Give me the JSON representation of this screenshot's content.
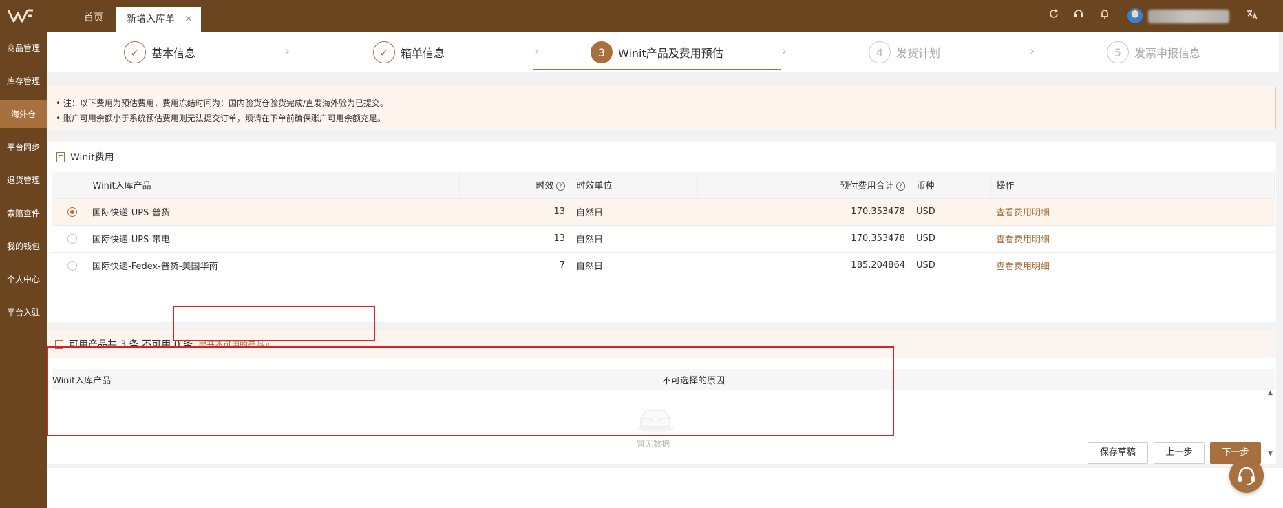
{
  "topbar": {
    "tabs": {
      "home": "首页",
      "active": "新增入库单"
    }
  },
  "sidebar": {
    "items": [
      "商品管理",
      "库存管理",
      "海外仓",
      "平台同步",
      "退货管理",
      "索赔查件",
      "我的钱包",
      "个人中心",
      "平台入驻"
    ],
    "active_index": 2
  },
  "steps": [
    {
      "num": "1",
      "label": "基本信息",
      "state": "done"
    },
    {
      "num": "2",
      "label": "箱单信息",
      "state": "done"
    },
    {
      "num": "3",
      "label": "Winit产品及费用预估",
      "state": "current"
    },
    {
      "num": "4",
      "label": "发货计划",
      "state": "pending"
    },
    {
      "num": "5",
      "label": "发票申报信息",
      "state": "pending"
    }
  ],
  "notice": {
    "line1": "• 注：以下费用为预估费用，费用冻结时间为：国内验货仓验货完成/直发海外验为已提交。",
    "line2": "• 账户可用余额小于系统预估费用则无法提交订单，烦请在下单前确保账户可用余额充足。"
  },
  "fee_section": {
    "title": "Winit费用",
    "columns": {
      "product": "Winit入库产品",
      "time": "时效",
      "time_unit": "时效单位",
      "total": "预付费用合计",
      "currency": "币种",
      "action": "操作"
    },
    "rows": [
      {
        "selected": true,
        "product": "国际快递-UPS-普货",
        "time": "13",
        "unit": "自然日",
        "total": "170.353478",
        "currency": "USD",
        "action": "查看费用明细"
      },
      {
        "selected": false,
        "product": "国际快递-UPS-带电",
        "time": "13",
        "unit": "自然日",
        "total": "170.353478",
        "currency": "USD",
        "action": "查看费用明细"
      },
      {
        "selected": false,
        "product": "国际快递-Fedex-普货-美国华南",
        "time": "7",
        "unit": "自然日",
        "total": "185.204864",
        "currency": "USD",
        "action": "查看费用明细"
      }
    ]
  },
  "available": {
    "summary": "可用产品共 3 条 不可用 0 条",
    "expand_label": "展开不可用的产品",
    "col_product": "Winit入库产品",
    "col_reason": "不可选择的原因",
    "empty_text": "暂无数据"
  },
  "footer": {
    "save_draft": "保存草稿",
    "prev": "上一步",
    "next": "下一步"
  },
  "colors": {
    "brand_dark": "#6b4520",
    "accent": "#a8703f",
    "highlight_box": "#e02020"
  }
}
